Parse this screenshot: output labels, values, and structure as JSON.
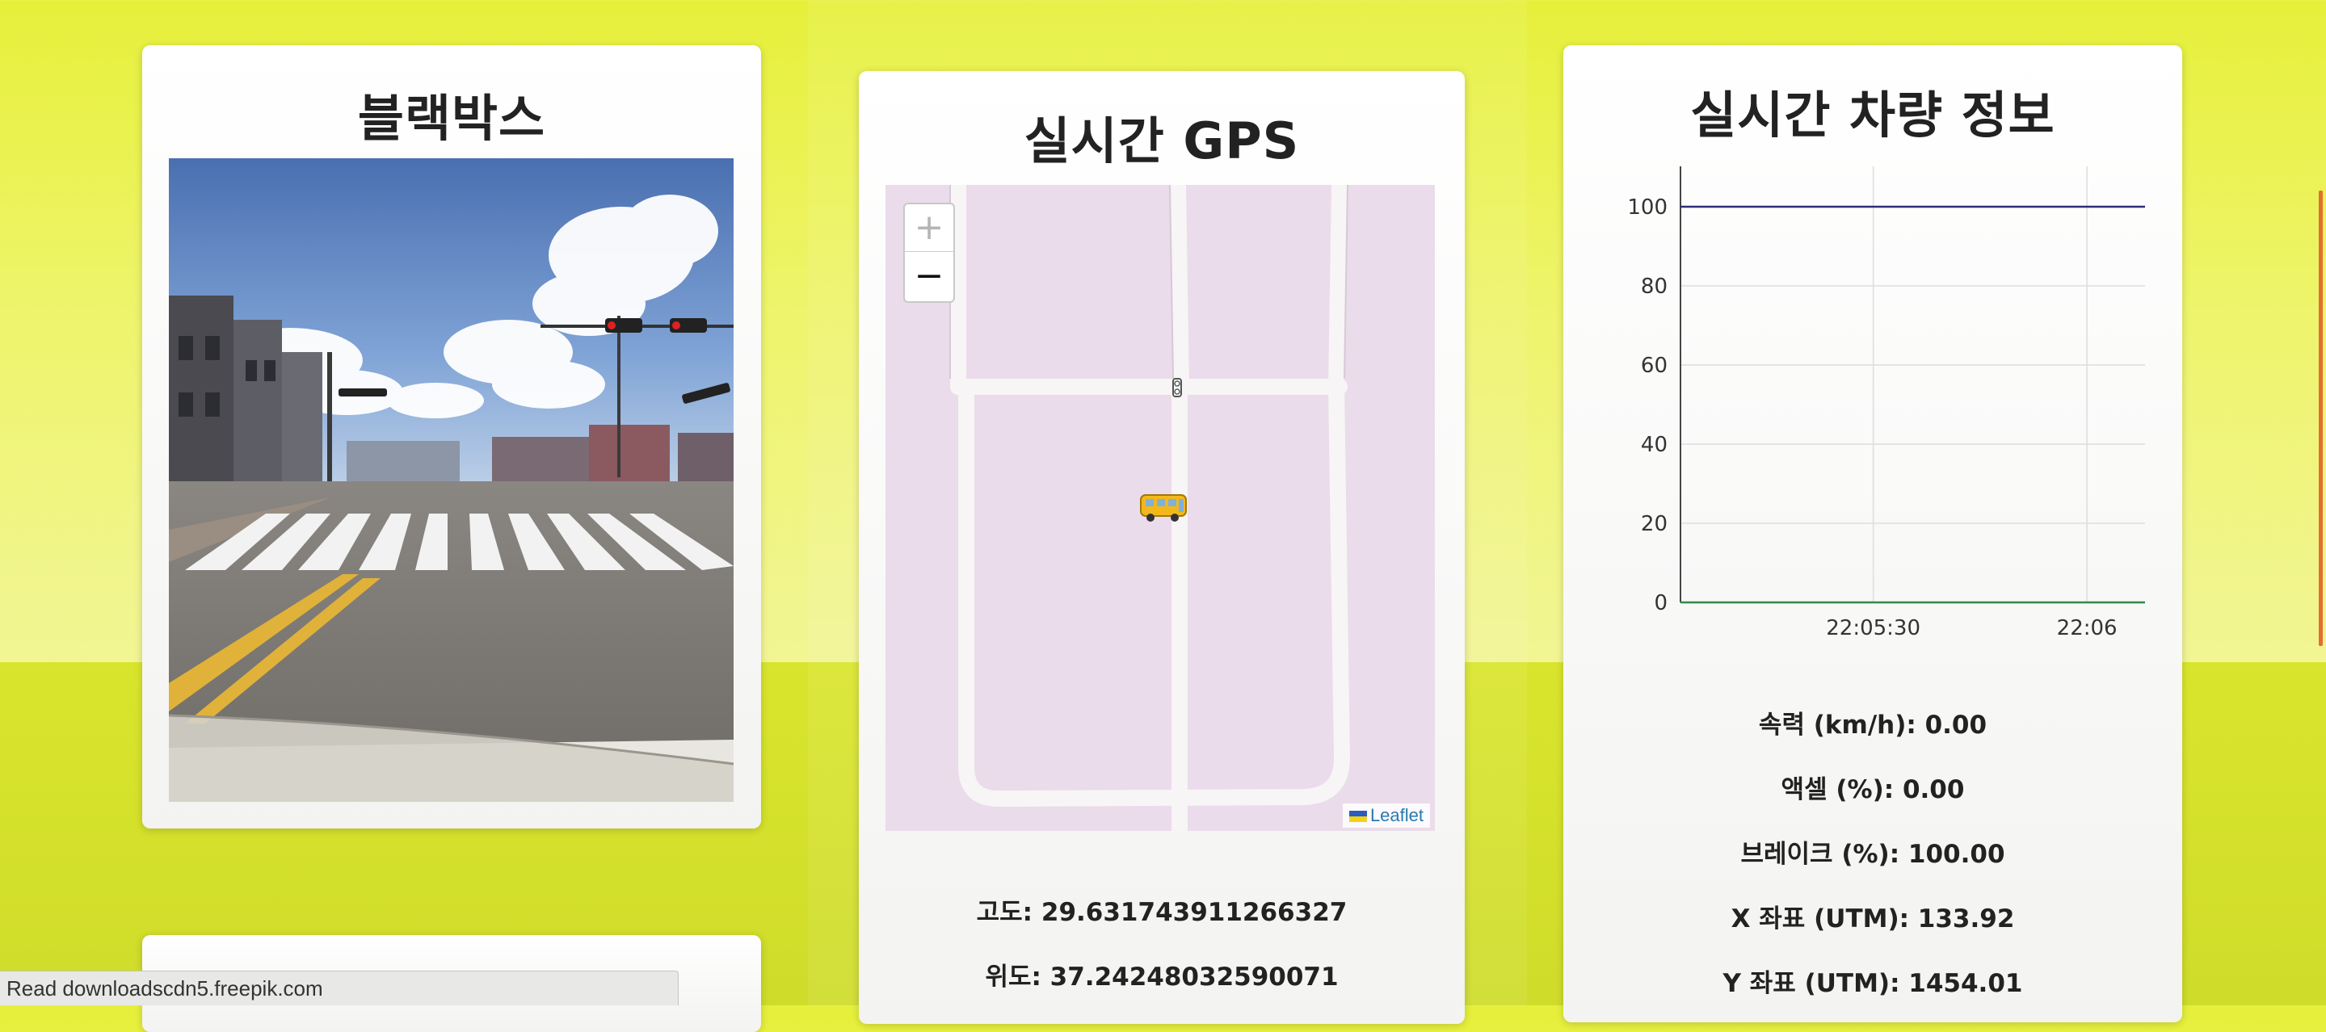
{
  "blackbox": {
    "title": "블랙박스"
  },
  "gps": {
    "title": "실시간 GPS",
    "zoom_in": "+",
    "zoom_out": "−",
    "attribution": "Leaflet",
    "marker_icon": "bus-icon",
    "altitude_text": "고도: 29.631743911266327",
    "latitude_text": "위도: 37.24248032590071"
  },
  "vehicle": {
    "title": "실시간 차량 정보",
    "speed_text": "속력 (km/h): 0.00",
    "accel_text": "액셀 (%): 0.00",
    "brake_text": "브레이크 (%): 100.00",
    "x_text": "X 좌표 (UTM): 133.92",
    "y_text": "Y 좌표 (UTM): 1454.01"
  },
  "chart_data": {
    "type": "line",
    "title": "",
    "xlabel": "",
    "ylabel": "",
    "ylim": [
      0,
      100
    ],
    "yticks": [
      "0",
      "20",
      "40",
      "60",
      "80",
      "100"
    ],
    "xticks": [
      "22:05:30",
      "22:06"
    ],
    "grid": true,
    "series": [
      {
        "color": "#2b2d7a",
        "values": [
          100,
          100,
          100,
          100,
          100
        ]
      },
      {
        "color": "#2f8a4a",
        "values": [
          0,
          0,
          0,
          0,
          0
        ]
      }
    ]
  },
  "statusbar": {
    "text": "Read downloadscdn5.freepik.com"
  },
  "colors": {
    "accent": "#e6f03a",
    "map_bg": "#eadcea",
    "road": "#f7f5f5"
  }
}
